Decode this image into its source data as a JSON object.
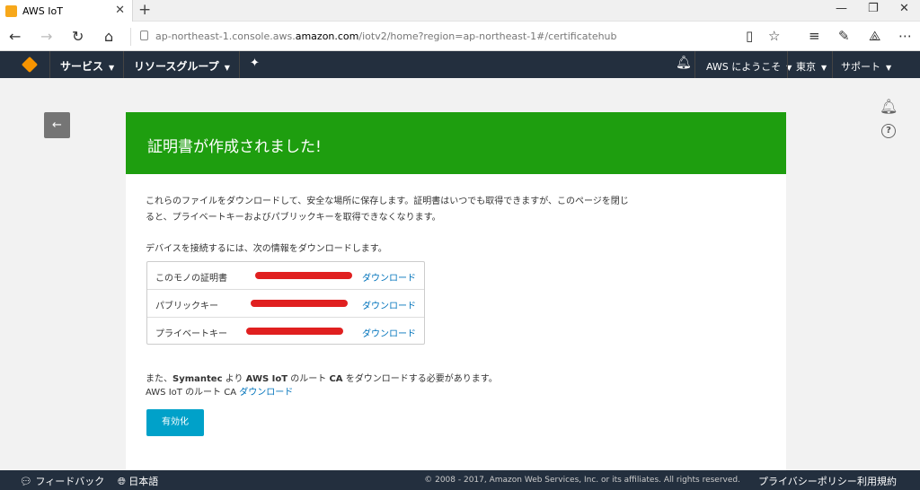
{
  "browser": {
    "tab_title": "AWS IoT",
    "new_tab": "+",
    "url_prefix": "ap-northeast-1.console.aws.",
    "url_domain": "amazon.com",
    "url_suffix": "/iotv2/home?region=ap-northeast-1#/certificatehub"
  },
  "topnav": {
    "services": "サービス",
    "resource_groups": "リソースグループ",
    "welcome": "AWS にようこそ",
    "region": "東京",
    "support": "サポート"
  },
  "main": {
    "banner_title": "証明書が作成されました!",
    "description": "これらのファイルをダウンロードして、安全な場所に保存します。証明書はいつでも取得できますが、このページを閉じると、プライベートキーおよびパブリックキーを取得できなくなります。",
    "device_info": "デバイスを接続するには、次の情報をダウンロードします。",
    "files": [
      {
        "label": "このモノの証明書",
        "action": "ダウンロード"
      },
      {
        "label": "パブリックキー",
        "action": "ダウンロード"
      },
      {
        "label": "プライベートキー",
        "action": "ダウンロード"
      }
    ],
    "symantec_pre": "また、",
    "symantec_name": "Symantec",
    "symantec_mid1": " より ",
    "symantec_iot": "AWS IoT",
    "symantec_mid2": " のルート ",
    "symantec_ca": "CA",
    "symantec_post": " をダウンロードする必要があります。",
    "rootca_label": "AWS IoT のルート CA ",
    "rootca_link": "ダウンロード",
    "activate_button": "有効化"
  },
  "footer": {
    "feedback": "フィードバック",
    "language": "日本語",
    "copyright": "© 2008 - 2017, Amazon Web Services, Inc. or its affiliates. All rights reserved.",
    "privacy": "プライバシーポリシー",
    "terms": "利用規約"
  },
  "colors": {
    "banner_green": "#1e9e0f",
    "nav_bg": "#232f3e",
    "link_blue": "#0073bb",
    "button_cyan": "#00a1c9",
    "redaction_red": "#e02020"
  }
}
